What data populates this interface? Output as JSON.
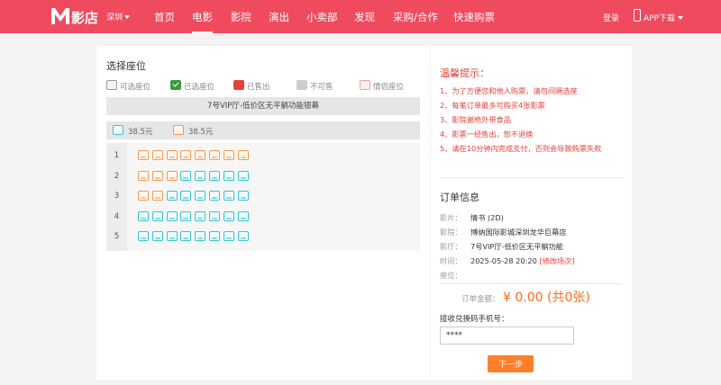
{
  "header": {
    "logo_text": "影店",
    "city": "深圳",
    "nav": [
      {
        "label": "首页",
        "active": false
      },
      {
        "label": "电影",
        "active": true
      },
      {
        "label": "影院",
        "active": false
      },
      {
        "label": "演出",
        "active": false
      },
      {
        "label": "小卖部",
        "active": false
      },
      {
        "label": "发现",
        "active": false
      },
      {
        "label": "采购/合作",
        "active": false
      },
      {
        "label": "快速购票",
        "active": false
      }
    ],
    "login": "登录",
    "app_download": "APP下载"
  },
  "seat_panel": {
    "title": "选择座位",
    "legend": {
      "available": "可选座位",
      "selected": "已选座位",
      "sold": "已售出",
      "unavailable": "不可售",
      "couple": "情侣座位"
    },
    "screen_name": "7号VIP厅-低价区无平躺功能银幕",
    "prices": [
      {
        "label": "38.5元",
        "color": "#36c4d3"
      },
      {
        "label": "38.5元",
        "color": "#f39a4f"
      }
    ],
    "rows": [
      {
        "num": "1",
        "seats": [
          "orange",
          "orange",
          "orange",
          "orange",
          "orange",
          "orange",
          "orange",
          "orange"
        ]
      },
      {
        "num": "2",
        "seats": [
          "orange",
          "orange",
          "orange",
          "cyan",
          "cyan",
          "cyan",
          "cyan",
          "cyan"
        ]
      },
      {
        "num": "3",
        "seats": [
          "orange",
          "orange",
          "cyan",
          "cyan",
          "cyan",
          "cyan",
          "cyan",
          "cyan"
        ]
      },
      {
        "num": "4",
        "seats": [
          "cyan",
          "cyan",
          "cyan",
          "cyan",
          "cyan",
          "cyan",
          "cyan",
          "cyan"
        ]
      },
      {
        "num": "5",
        "seats": [
          "cyan",
          "cyan",
          "cyan",
          "cyan",
          "cyan",
          "cyan",
          "cyan",
          "cyan"
        ]
      }
    ]
  },
  "tips": {
    "title": "温馨提示：",
    "items": [
      "1、为了方便您和他人购票，请勿间隔选座",
      "2、每笔订单最多可购买4张影票",
      "3、影院谢绝外带食品",
      "4、影票一经售出，恕不退换",
      "5、请在10分钟内完成支付，否则会导致购票失败"
    ]
  },
  "order": {
    "title": "订单信息",
    "film_label": "影片：",
    "film": "情书 (2D)",
    "cinema_label": "影院：",
    "cinema": "博纳国际影城深圳龙华巨幕店",
    "hall_label": "影厅：",
    "hall": "7号VIP厅-低价区无平躺功能",
    "time_label": "时间：",
    "time": "2025-05-28 20:20",
    "modify": "[修改场次]",
    "seat_label": "座位：",
    "amount_label": "订单金额：",
    "amount": "¥ 0.00 (共0张)",
    "phone_label": "接收兑换码手机号：",
    "phone_value": "****",
    "next_button": "下一步"
  }
}
